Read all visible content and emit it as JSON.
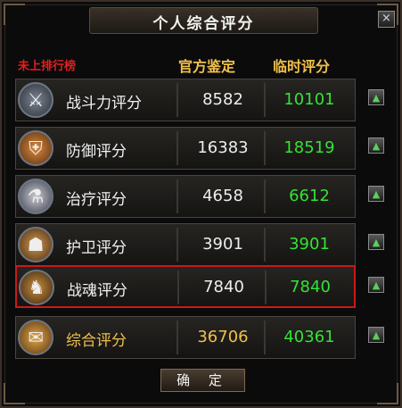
{
  "window": {
    "title": "个人综合评分",
    "close_icon": "×"
  },
  "header": {
    "rank_label": "未上排行榜",
    "col_official": "官方鉴定",
    "col_temp": "临时评分"
  },
  "rows": [
    {
      "label": "战斗力评分",
      "official": "8582",
      "temp": "10101",
      "icon": "crossed-swords-icon"
    },
    {
      "label": "防御评分",
      "official": "16383",
      "temp": "18519",
      "icon": "shield-icon"
    },
    {
      "label": "治疗评分",
      "official": "4658",
      "temp": "6612",
      "icon": "potion-icon"
    },
    {
      "label": "护卫评分",
      "official": "3901",
      "temp": "3901",
      "icon": "guard-icon"
    },
    {
      "label": "战魂评分",
      "official": "7840",
      "temp": "7840",
      "icon": "warrior-spirit-icon",
      "highlighted": true
    },
    {
      "label": "综合评分",
      "official": "36706",
      "temp": "40361",
      "icon": "scroll-icon",
      "gold": true
    }
  ],
  "footer": {
    "ok_label": "确 定"
  },
  "colors": {
    "accent_gold": "#f0c04a",
    "temp_green": "#35e235",
    "highlight_red": "#c81a1a",
    "rank_red": "#e02020"
  }
}
